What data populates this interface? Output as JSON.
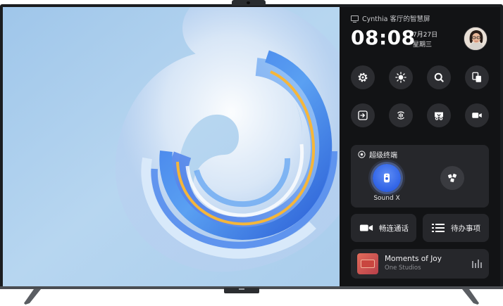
{
  "panel": {
    "device_name": "Cynthia 客厅的智慧屏",
    "time": "08:08",
    "date": "7月27日",
    "weekday": "星期三"
  },
  "quick_actions": [
    {
      "icon": "gear-icon"
    },
    {
      "icon": "brightness-icon"
    },
    {
      "icon": "search-icon"
    },
    {
      "icon": "screen-share-icon"
    },
    {
      "icon": "input-source-icon"
    },
    {
      "icon": "voice-icon"
    },
    {
      "icon": "projection-icon"
    },
    {
      "icon": "video-camera-icon"
    }
  ],
  "super_device": {
    "title": "超级终端",
    "devices": [
      {
        "label": "Sound X",
        "icon": "speaker-icon",
        "active": true
      },
      {
        "label": "",
        "icon": "devices-icon",
        "active": false
      }
    ]
  },
  "shortcuts": {
    "call_label": "畅连通话",
    "todo_label": "待办事项"
  },
  "music": {
    "title": "Moments of Joy",
    "artist": "One Studios"
  },
  "colors": {
    "panel_bg": "#121315",
    "card_bg": "#26272b",
    "button_bg": "#2c2d31",
    "accent_blue": "#2f62e6",
    "album_red": "#c9463f"
  }
}
